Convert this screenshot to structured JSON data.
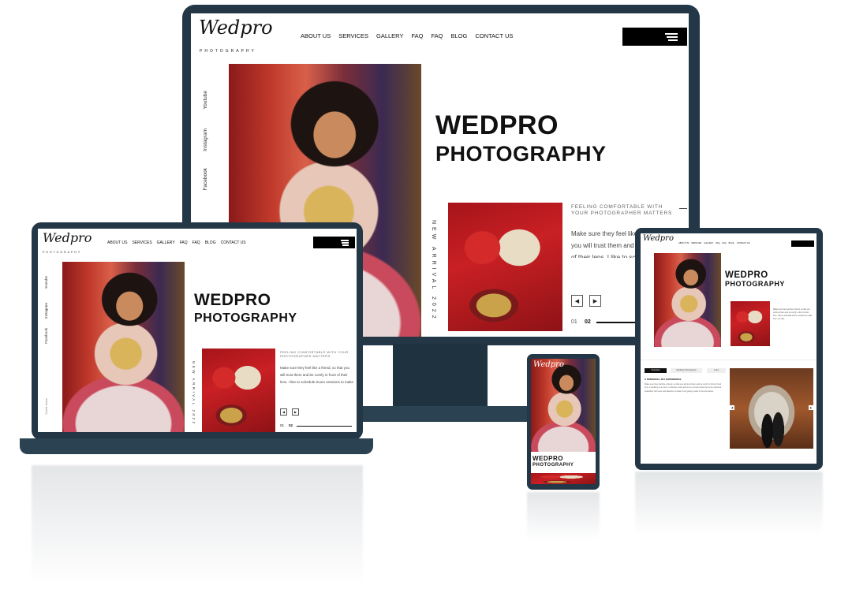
{
  "brand": {
    "logo": "Wedpro",
    "sub": "PHOTOGRAPHY"
  },
  "nav": [
    "ABOUT US",
    "SERVICES",
    "GALLERY",
    "FAQ",
    "FAQ",
    "BLOG",
    "CONTACT US"
  ],
  "hero": {
    "line1": "WEDPRO",
    "line2": "PHOTOGRAPHY"
  },
  "social": {
    "youtube": "Youtube",
    "instagram": "Instagram",
    "facebook": "Facebook"
  },
  "arrival": "NEW ARRIVAL 2022",
  "feature": {
    "title": "FEELING COMFORTABLE WITH YOUR PHOTOGRAPHER MATTERS",
    "body_desktop": "Make sure they feel like a friend, so that you will trust them and be comfy in front of their lens. I like to schedule Zoom sessions to make sure, we vibe",
    "body_laptop": "Make sure they feel like a friend, so that you will trust them and be comfy in front of their lens. I like to schedule Zoom sessions to make sure, we vibe."
  },
  "pager": {
    "p1": "01",
    "p2": "02"
  },
  "arrows": {
    "prev": "◀",
    "next": "▶"
  },
  "scroll": "Scroll down",
  "tablet": {
    "tabs": [
      "Overview",
      "Wedding Photography",
      "Links"
    ],
    "section_title": "A PERSONAL JOY EXPERIENCE",
    "paragraph": "Make sure they feel like a friend, so that you will trust them and be comfy in front of their lens. A wedding is a once in a lifetime event and every moment deserves to be captured beautifully with care and attention to detail, from getting ready to the last dance."
  },
  "colors": {
    "frame": "#243746",
    "accent": "#000000"
  }
}
